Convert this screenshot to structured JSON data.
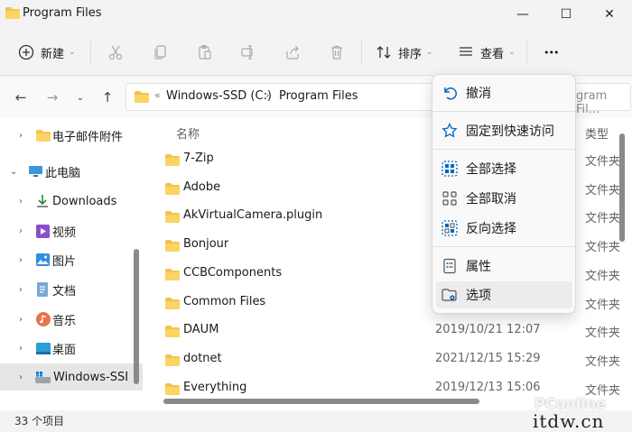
{
  "window": {
    "title": "Program Files",
    "minimize_glyph": "—",
    "maximize_glyph": "☐",
    "close_glyph": "✕"
  },
  "toolbar": {
    "new_label": "新建",
    "sort_label": "排序",
    "view_label": "查看",
    "more_glyph": "•••",
    "icons": [
      "plus-circle-icon",
      "cut-icon",
      "copy-icon",
      "paste-icon",
      "rename-icon",
      "share-icon",
      "delete-icon",
      "sort-icon",
      "view-icon",
      "more-icon"
    ]
  },
  "address": {
    "segments": [
      "Windows-SSD (C:)",
      "Program Files"
    ],
    "overflow_glyph": "«",
    "search_placeholder": "gram Fil..."
  },
  "nav": {
    "items": [
      {
        "label": "电子邮件附件",
        "icon": "folder-icon",
        "expanded": false
      },
      {
        "label": "此电脑",
        "icon": "computer-icon",
        "expanded": true
      },
      {
        "label": "Downloads",
        "icon": "download-icon",
        "expanded": false
      },
      {
        "label": "视频",
        "icon": "video-icon",
        "expanded": false
      },
      {
        "label": "图片",
        "icon": "pictures-icon",
        "expanded": false
      },
      {
        "label": "文档",
        "icon": "documents-icon",
        "expanded": false
      },
      {
        "label": "音乐",
        "icon": "music-icon",
        "expanded": false
      },
      {
        "label": "桌面",
        "icon": "desktop-icon",
        "expanded": false
      },
      {
        "label": "Windows-SSD",
        "icon": "drive-icon",
        "expanded": false,
        "selected": true
      }
    ]
  },
  "files": {
    "columns": {
      "name": "名称",
      "type": "类型"
    },
    "rows": [
      {
        "name": "7-Zip",
        "date": "",
        "type": "文件夹"
      },
      {
        "name": "Adobe",
        "date": "",
        "type": "文件夹"
      },
      {
        "name": "AkVirtualCamera.plugin",
        "date": "",
        "type": "文件夹"
      },
      {
        "name": "Bonjour",
        "date": "",
        "type": "文件夹"
      },
      {
        "name": "CCBComponents",
        "date": "",
        "type": "文件夹"
      },
      {
        "name": "Common Files",
        "date": "",
        "type": "文件夹"
      },
      {
        "name": "DAUM",
        "date": "2019/10/21 12:07",
        "type": "文件夹"
      },
      {
        "name": "dotnet",
        "date": "2021/12/15 15:29",
        "type": "文件夹"
      },
      {
        "name": "Everything",
        "date": "2019/12/13 15:06",
        "type": "文件夹"
      }
    ]
  },
  "status": {
    "count_text": "33 个项目"
  },
  "watermark": {
    "brand": "PConline",
    "site": "itdw.cn"
  },
  "context_menu": {
    "items": [
      {
        "label": "撤消",
        "icon": "undo-icon"
      },
      {
        "label": "固定到快速访问",
        "icon": "star-pin-icon"
      },
      {
        "label": "全部选择",
        "icon": "select-all-icon"
      },
      {
        "label": "全部取消",
        "icon": "select-none-icon"
      },
      {
        "label": "反向选择",
        "icon": "invert-selection-icon"
      },
      {
        "label": "属性",
        "icon": "properties-icon"
      },
      {
        "label": "选项",
        "icon": "folder-options-icon"
      }
    ]
  },
  "colors": {
    "accent": "#0067c0",
    "folder": "#f2c24f"
  }
}
